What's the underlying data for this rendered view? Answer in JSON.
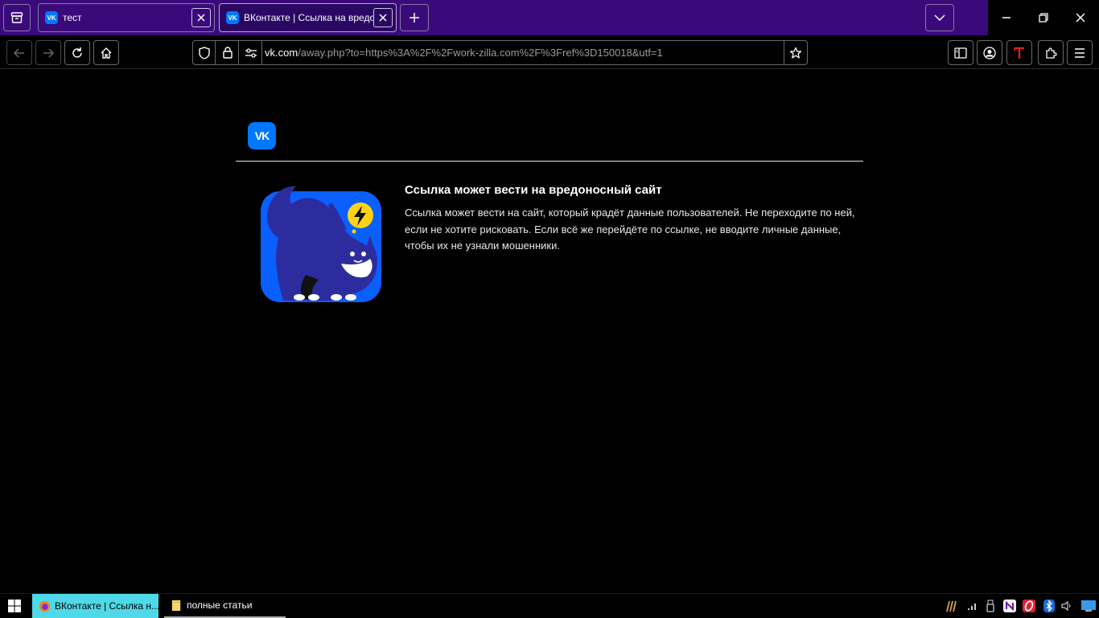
{
  "tabs": [
    {
      "title": "тест",
      "favicon": "vk-favicon",
      "active": false
    },
    {
      "title": "ВКонтакте | Ссылка на вредоносный сайт",
      "favicon": "vk-favicon",
      "active": true
    }
  ],
  "toolbar": {
    "url_domain": "vk.com",
    "url_path": "/away.php?to=https%3A%2F%2Fwork-zilla.com%2F%3Fref%3D150018&utf=1"
  },
  "page": {
    "logo_text": "VK",
    "warning_title": "Ссылка может вести на вредоносный сайт",
    "warning_text": "Ссылка может вести на сайт, который крадёт данные пользователей. Не переходите по ней, если не хотите рисковать. Если всё же перейдёте по ссылке, не вводите личные данные, чтобы их не узнали мошенники."
  },
  "taskbar": {
    "tasks": [
      {
        "label": "ВКонтакте | Ссылка н...",
        "icon": "firefox-icon",
        "active": true
      },
      {
        "label": "полные статьи",
        "icon": "folder-icon",
        "active": false
      }
    ]
  },
  "colors": {
    "tabstrip": "#3a0a7a",
    "vk_blue": "#0077ff",
    "taskbar_active": "#4fd8e8"
  }
}
